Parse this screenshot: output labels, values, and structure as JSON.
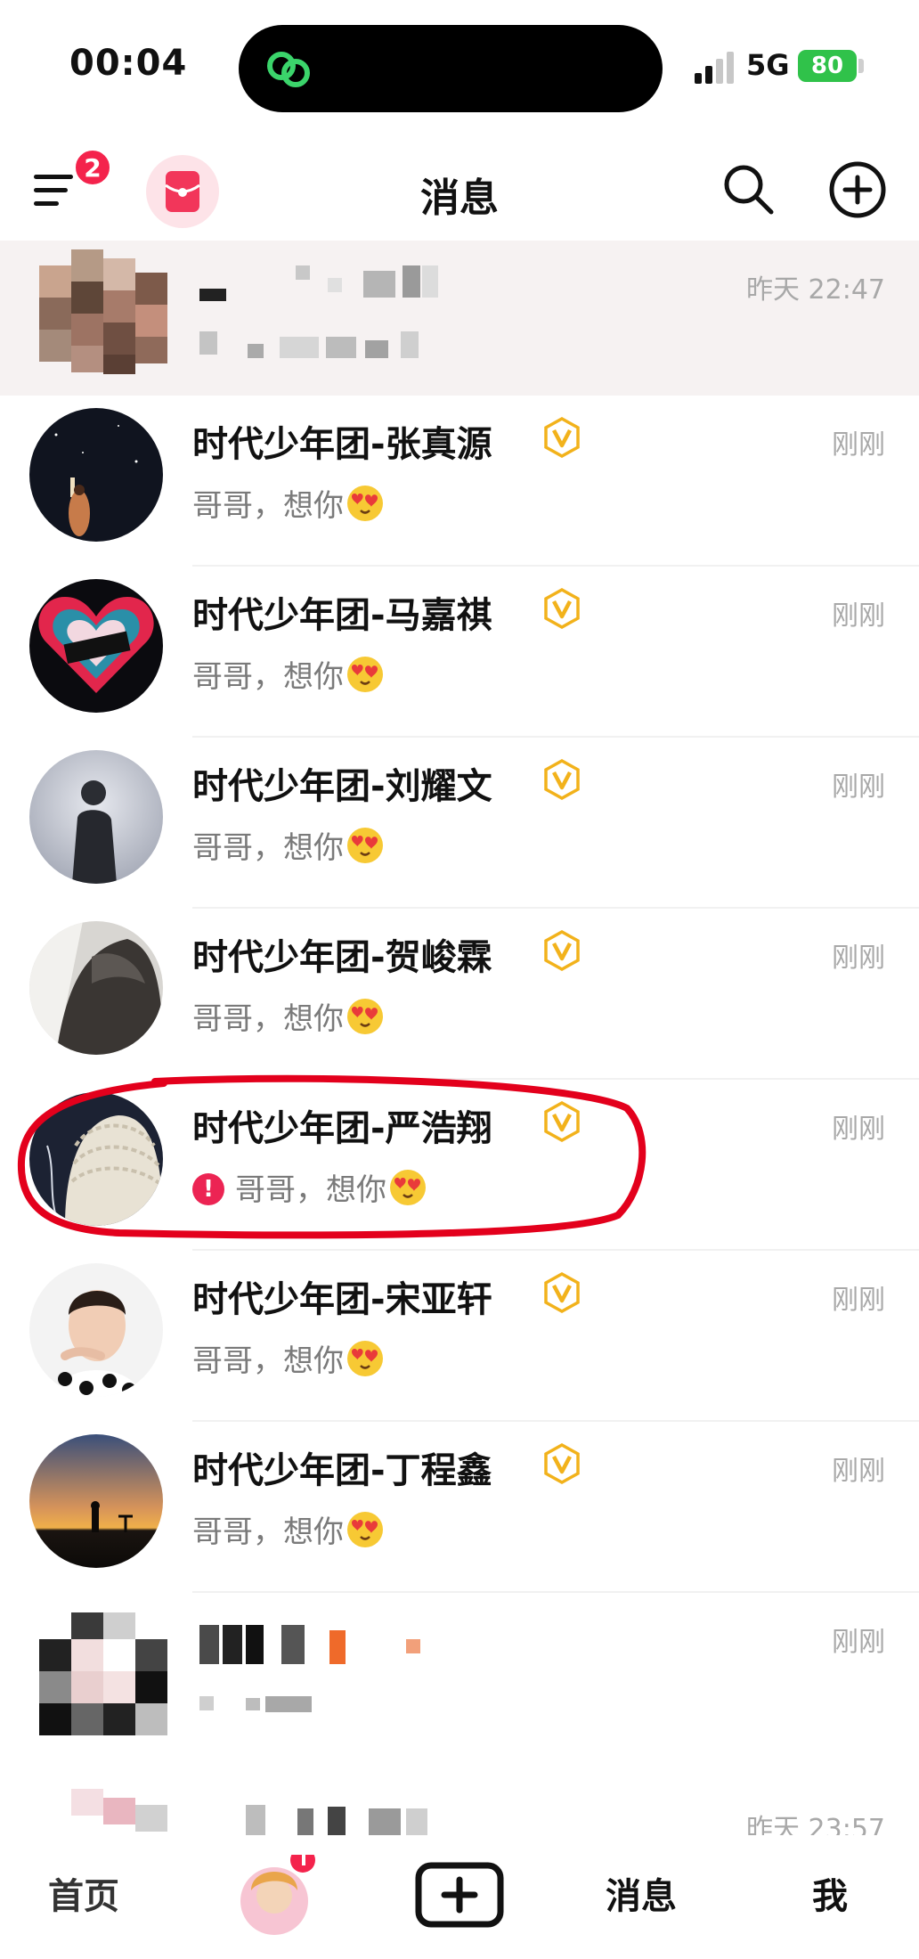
{
  "status_bar": {
    "time": "00:04",
    "network": "5G",
    "battery": "80"
  },
  "header": {
    "menu_badge": "2",
    "title": "消息"
  },
  "conversations": [
    {
      "name": "",
      "preview": "",
      "time": "昨天 22:47",
      "blurred": true
    },
    {
      "name": "时代少年团-张真源",
      "preview": "哥哥，想你",
      "time": "刚刚",
      "verified": true
    },
    {
      "name": "时代少年团-马嘉祺",
      "preview": "哥哥，想你",
      "time": "刚刚",
      "verified": true
    },
    {
      "name": "时代少年团-刘耀文",
      "preview": "哥哥，想你",
      "time": "刚刚",
      "verified": true
    },
    {
      "name": "时代少年团-贺峻霖",
      "preview": "哥哥，想你",
      "time": "刚刚",
      "verified": true
    },
    {
      "name": "时代少年团-严浩翔",
      "preview": "哥哥，想你",
      "time": "刚刚",
      "verified": true,
      "send_failed": true,
      "highlighted": true
    },
    {
      "name": "时代少年团-宋亚轩",
      "preview": "哥哥，想你",
      "time": "刚刚",
      "verified": true
    },
    {
      "name": "时代少年团-丁程鑫",
      "preview": "哥哥，想你",
      "time": "刚刚",
      "verified": true
    },
    {
      "name": "",
      "preview": "",
      "time": "刚刚",
      "blurred": true
    },
    {
      "name": "",
      "preview": "",
      "time": "昨天 23:57",
      "blurred": true
    }
  ],
  "bottom_nav": {
    "home": "首页",
    "messages": "消息",
    "me": "我"
  },
  "icons": [
    "menu-icon",
    "red-packet-icon",
    "search-icon",
    "add-circle-icon",
    "verified-v-icon",
    "heart-eyes-emoji",
    "alert-icon",
    "plus-square-icon"
  ],
  "colors": {
    "badge_red": "#f4234c",
    "verified_gold": "#f2b21b",
    "highlight_red": "#e3001c",
    "battery_green": "#30c24a"
  }
}
